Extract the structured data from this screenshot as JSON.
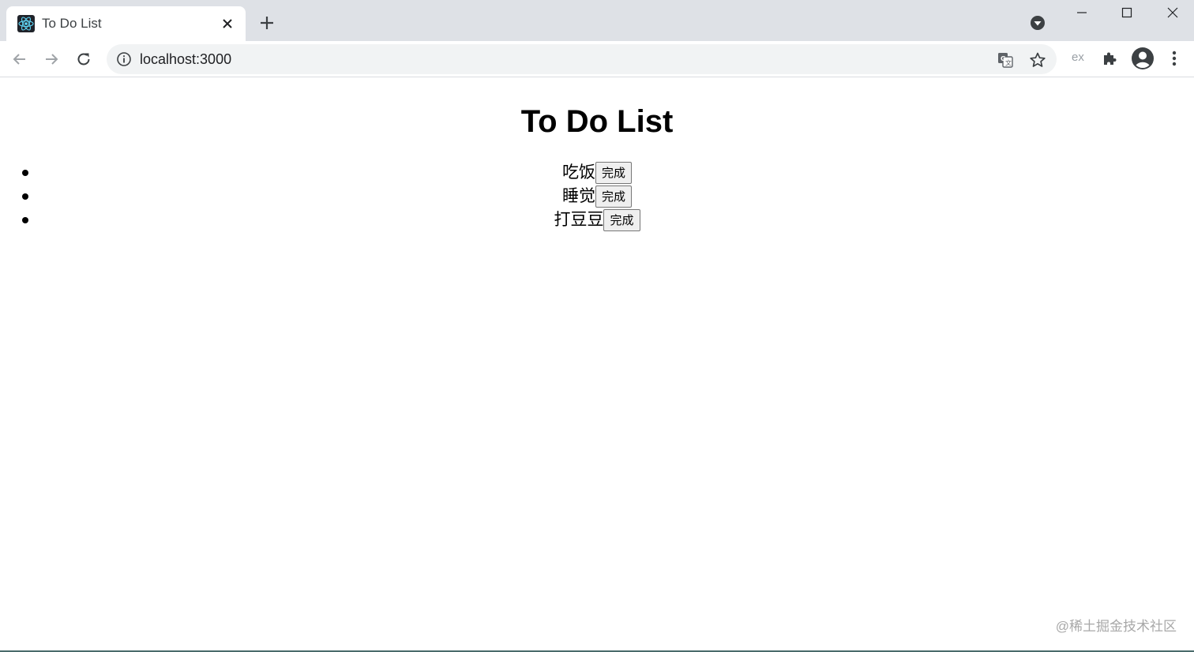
{
  "browser": {
    "tab": {
      "title": "To Do List",
      "favicon": "react-logo-icon"
    },
    "address_bar": {
      "url": "localhost:3000"
    },
    "toolbar": {
      "extension_ex_label": "ex"
    }
  },
  "page": {
    "title": "To Do List",
    "todos": [
      {
        "text": "吃饭",
        "button_label": "完成"
      },
      {
        "text": "睡觉",
        "button_label": "完成"
      },
      {
        "text": "打豆豆",
        "button_label": "完成"
      }
    ],
    "watermark": "@稀土掘金技术社区"
  },
  "colors": {
    "tabstrip_bg": "#dee1e6",
    "omnibox_bg": "#f1f3f4",
    "react_blue": "#61dafb"
  }
}
